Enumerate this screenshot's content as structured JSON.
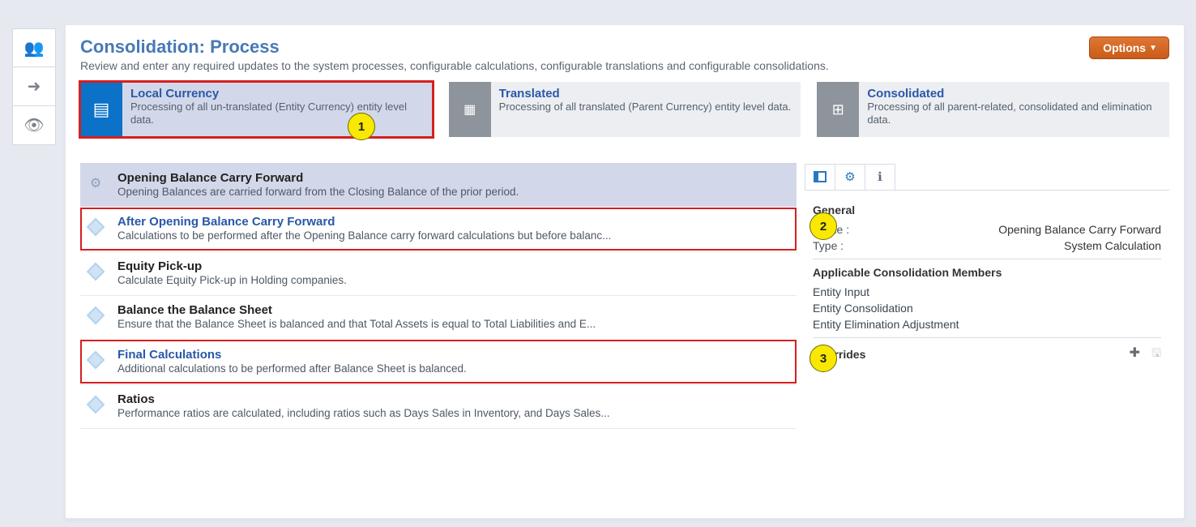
{
  "header": {
    "title": "Consolidation: Process",
    "subtitle": "Review and enter any required updates to the system processes, configurable calculations, configurable translations and configurable consolidations.",
    "options_label": "Options"
  },
  "tiles": {
    "local": {
      "title": "Local Currency",
      "sub": "Processing of all un-translated (Entity Currency) entity level data."
    },
    "translated": {
      "title": "Translated",
      "sub": "Processing of all translated (Parent Currency) entity level data."
    },
    "consolidated": {
      "title": "Consolidated",
      "sub": "Processing of all parent-related, consolidated and elimination data."
    }
  },
  "callouts": {
    "one": "1",
    "two": "2",
    "three": "3"
  },
  "list": [
    {
      "title": "Opening Balance Carry Forward",
      "sub": "Opening Balances are carried forward from the Closing Balance of the prior period."
    },
    {
      "title": "After Opening Balance Carry Forward",
      "sub": "Calculations to be performed after the Opening Balance carry forward calculations but before balanc..."
    },
    {
      "title": "Equity Pick-up",
      "sub": "Calculate Equity Pick-up in Holding companies."
    },
    {
      "title": "Balance the Balance Sheet",
      "sub": "Ensure that the Balance Sheet is balanced and that Total Assets is equal to Total Liabilities and E..."
    },
    {
      "title": "Final Calculations",
      "sub": "Additional calculations to be performed after Balance Sheet is balanced."
    },
    {
      "title": "Ratios",
      "sub": "Performance ratios are calculated, including ratios such as Days Sales in Inventory, and Days Sales..."
    }
  ],
  "inspector": {
    "general_label": "General",
    "name_label": "Name :",
    "name_value": "Opening Balance Carry Forward",
    "type_label": "Type  :",
    "type_value": "System Calculation",
    "members_label": "Applicable Consolidation Members",
    "members": {
      "m0": "Entity Input",
      "m1": "Entity Consolidation",
      "m2": "Entity Elimination Adjustment"
    },
    "overrides_label": "Overrides"
  }
}
